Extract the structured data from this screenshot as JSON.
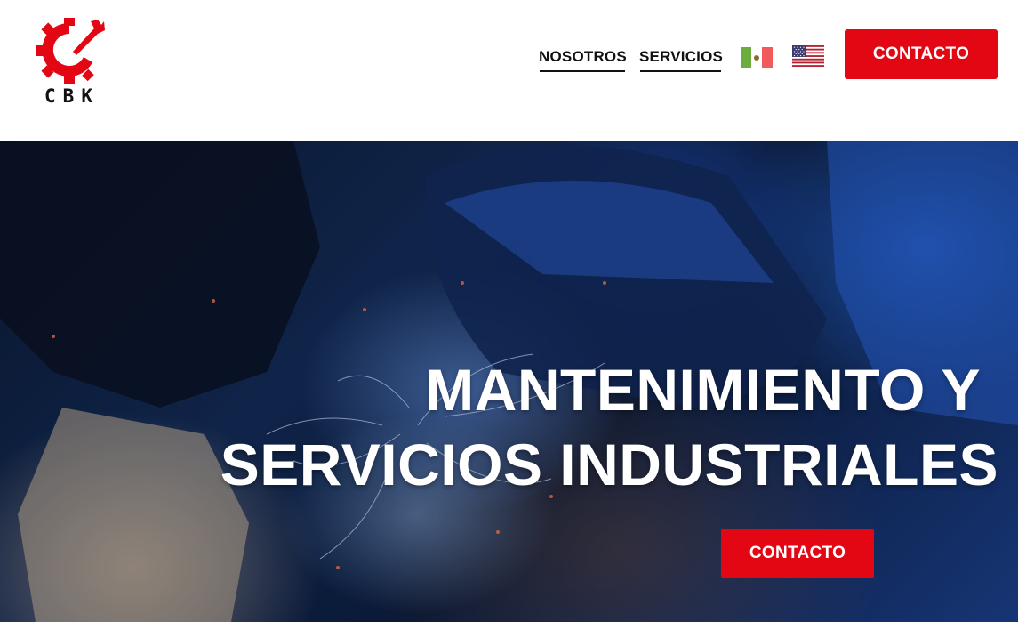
{
  "logo": {
    "text": "CBK",
    "color": "#e30613"
  },
  "nav": {
    "items": [
      {
        "label": "NOSOTROS"
      },
      {
        "label": "SERVICIOS"
      }
    ],
    "languages": [
      {
        "name": "mexico-flag",
        "colors": [
          "#6cae3e",
          "#ffffff",
          "#f15a5a"
        ]
      },
      {
        "name": "usa-flag",
        "colors": [
          "#b22234",
          "#ffffff",
          "#3c3b6e"
        ]
      }
    ],
    "cta_label": "CONTACTO"
  },
  "hero": {
    "headline_line1": "MANTENIMIENTO Y",
    "headline_line2": "SERVICIOS INDUSTRIALES",
    "cta_label": "CONTACTO"
  },
  "colors": {
    "accent": "#e30613",
    "text": "#111111"
  }
}
